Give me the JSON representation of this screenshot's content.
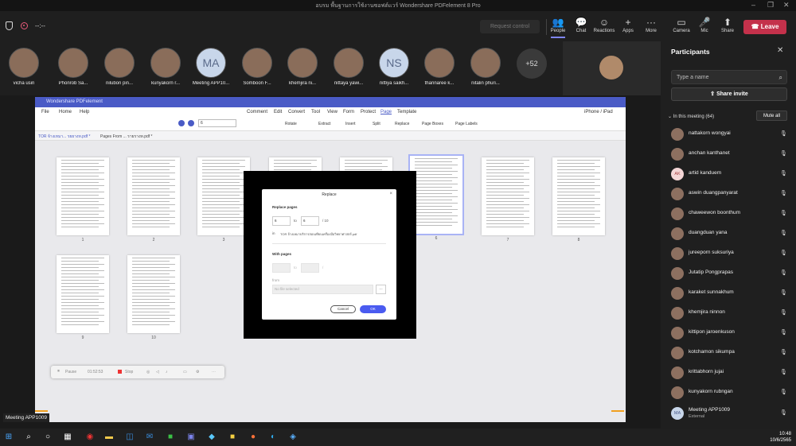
{
  "window_title": "อบรม พื้นฐานการใช้งานซอฟต์แวร์ Wondershare PDFelement 8 Pro",
  "window_controls": [
    "–",
    "❐",
    "✕"
  ],
  "toolbar": {
    "timer": "--:--",
    "request_control": "Request control",
    "buttons": [
      {
        "label": "People",
        "icon": "people-icon",
        "glyph": "👥"
      },
      {
        "label": "Chat",
        "icon": "chat-icon",
        "glyph": "💬"
      },
      {
        "label": "Reactions",
        "icon": "reactions-icon",
        "glyph": "☺"
      },
      {
        "label": "Apps",
        "icon": "apps-icon",
        "glyph": "+"
      },
      {
        "label": "More",
        "icon": "more-icon",
        "glyph": "···"
      },
      {
        "label": "Camera",
        "icon": "camera-off-icon",
        "glyph": "▭"
      },
      {
        "label": "Mic",
        "icon": "mic-off-icon",
        "glyph": "🎤"
      },
      {
        "label": "Share",
        "icon": "share-icon",
        "glyph": "⬆"
      }
    ],
    "leave": "Leave"
  },
  "strip": {
    "participants": [
      {
        "name": "vicha usiri",
        "initials": ""
      },
      {
        "name": "Phonrob Sa...",
        "initials": ""
      },
      {
        "name": "nilubon pin...",
        "initials": ""
      },
      {
        "name": "kunyakorn r...",
        "initials": ""
      },
      {
        "name": "Meeting APP10...",
        "initials": "MA"
      },
      {
        "name": "Somboon F...",
        "initials": ""
      },
      {
        "name": "khemjira ni...",
        "initials": ""
      },
      {
        "name": "nittaya yawi...",
        "initials": ""
      },
      {
        "name": "nittiya saikh...",
        "initials": "NS"
      },
      {
        "name": "thannaree k...",
        "initials": ""
      },
      {
        "name": "nitalin phuri...",
        "initials": ""
      }
    ],
    "more_count": "+52"
  },
  "pdf": {
    "title": "Wondershare PDFelement",
    "doc_title": "TOR จ้างเหมา...",
    "menu": [
      "File",
      "Home",
      "Help",
      "Comment",
      "Edit",
      "Convert",
      "Tool",
      "View",
      "Form",
      "Protect",
      "Page",
      "Template"
    ],
    "device": "iPhone / iPad",
    "page_tools": [
      "Rotate",
      "Extract",
      "Insert",
      "Split",
      "Replace",
      "Page Boxes",
      "Page Labels"
    ],
    "zoom_value": "6",
    "tabs": [
      "TOR จ้างเหมา... รยยางท.pdf *",
      "Pages From ... รายรางท.pdf *"
    ],
    "page_numbers": [
      "1",
      "2",
      "3",
      "4",
      "5",
      "6",
      "7",
      "8",
      "9",
      "10"
    ]
  },
  "dialog": {
    "title": "Replace",
    "replace_pages_label": "Replace pages",
    "from_value": "6",
    "to_label": "to",
    "to_value": "6",
    "total": "/ 10",
    "in_label": "in",
    "in_file": "TOR จ้างเหมาบริการสอบเทียบเครื่องมือวิทยาศาสตร์.pdf",
    "with_pages_label": "With pages",
    "with_to_label": "to",
    "with_slash": "/",
    "from_label": "from",
    "from_placeholder": "No file selected",
    "browse": "···",
    "cancel": "Cancel",
    "ok": "OK"
  },
  "floatbar": {
    "pause": "Pause",
    "time": "01:52:53",
    "stop": "Stop"
  },
  "stage_label": "Meeting APP1009",
  "panel": {
    "title": "Participants",
    "search_placeholder": "Type a name",
    "share_invite": "Share invite",
    "in_meeting": "In this meeting (64)",
    "mute_all": "Mute all",
    "people": [
      {
        "name": "nattakorn wongyai",
        "initials": ""
      },
      {
        "name": "anchan kanthanet",
        "initials": ""
      },
      {
        "name": "artid kanduem",
        "initials": "AK"
      },
      {
        "name": "aswin duangpanyarat",
        "initials": ""
      },
      {
        "name": "chaweewon boonthum",
        "initials": ""
      },
      {
        "name": "duangduan yana",
        "initials": ""
      },
      {
        "name": "jureeporn suksuriya",
        "initials": ""
      },
      {
        "name": "Jutatip Pongprapas",
        "initials": ""
      },
      {
        "name": "karaket sunnakhum",
        "initials": ""
      },
      {
        "name": "khemjira ninnon",
        "initials": ""
      },
      {
        "name": "kittipon jaroenkuson",
        "initials": ""
      },
      {
        "name": "kotchamon sikumpa",
        "initials": ""
      },
      {
        "name": "krittabhorn jujai",
        "initials": ""
      },
      {
        "name": "kunyakorn rubngan",
        "initials": ""
      }
    ],
    "external": {
      "name": "Meeting APP1009",
      "role": "External",
      "initials": "MA"
    }
  },
  "taskbar": {
    "time": "10:48",
    "date": "10/6/2565"
  },
  "colors": {
    "leave": "#c4314b",
    "accent": "#7f85f5",
    "pdf_title": "#4a5bc6",
    "ok_button": "#4a5bf0"
  }
}
